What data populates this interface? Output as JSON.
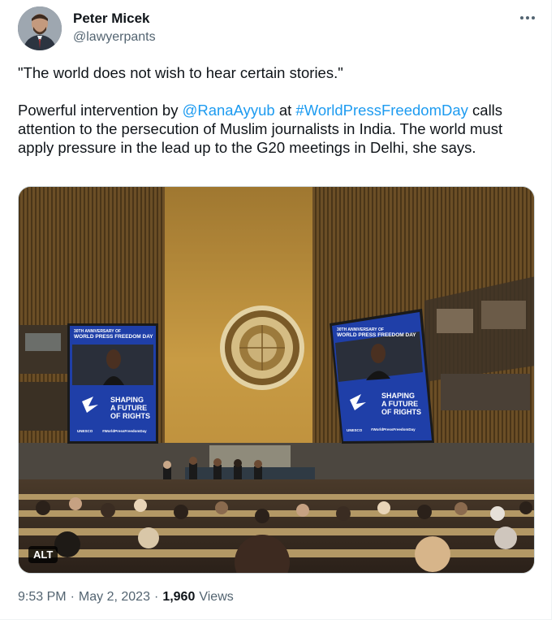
{
  "author": {
    "name": "Peter Micek",
    "handle": "@lawyerpants"
  },
  "tweet": {
    "quote": "\"The world does not wish to hear certain stories.\"",
    "body_prefix": "Powerful intervention by ",
    "mention": "@RanaAyyub",
    "body_middle": " at ",
    "hashtag": "#WorldPressFreedomDay",
    "body_suffix": " calls attention to the persecution of Muslim journalists in India. The world must apply pressure in the lead up to the G20 meetings in Delhi, she says."
  },
  "media": {
    "alt_badge": "ALT",
    "left_screen": {
      "anniversary": "30TH ANNIVERSARY OF",
      "title": "WORLD PRESS FREEDOM DAY",
      "slogan_line1": "SHAPING",
      "slogan_line2": "A FUTURE",
      "slogan_line3": "OF RIGHTS",
      "org": "UNESCO",
      "hashtag": "#WorldPressFreedomDay"
    },
    "right_screen": {
      "anniversary": "30TH ANNIVERSARY OF",
      "title": "WORLD PRESS FREEDOM DAY",
      "slogan_line1": "SHAPING",
      "slogan_line2": "A FUTURE",
      "slogan_line3": "OF RIGHTS",
      "org": "UNESCO",
      "hashtag": "#WorldPressFreedomDay"
    }
  },
  "meta": {
    "time": "9:53 PM",
    "separator": "·",
    "date": "May 2, 2023",
    "views_count": "1,960",
    "views_label": "Views"
  },
  "colors": {
    "link": "#1d9bf0",
    "text": "#0f1419",
    "secondary": "#536471",
    "screen_blue": "#1f3fa8",
    "wall_gold": "#c2953f"
  }
}
